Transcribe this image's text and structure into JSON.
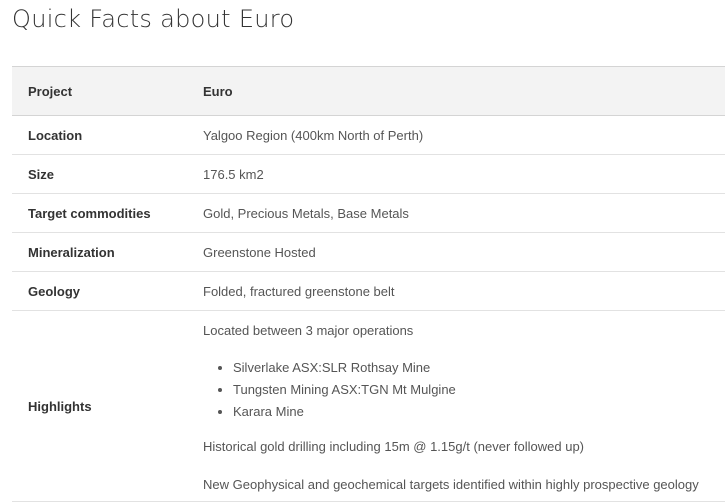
{
  "page": {
    "title": "Quick Facts about Euro"
  },
  "table": {
    "header": {
      "label": "Project",
      "value": "Euro"
    },
    "rows": [
      {
        "label": "Location",
        "value": "Yalgoo Region (400km North of Perth)"
      },
      {
        "label": "Size",
        "value": "176.5 km2"
      },
      {
        "label": "Target commodities",
        "value": "Gold, Precious Metals, Base Metals"
      },
      {
        "label": "Mineralization",
        "value": "Greenstone Hosted"
      },
      {
        "label": "Geology",
        "value": "Folded, fractured greenstone belt"
      }
    ],
    "highlights": {
      "label": "Highlights",
      "intro": "Located between 3 major operations",
      "operations": [
        "Silverlake ASX:SLR Rothsay Mine",
        "Tungsten Mining ASX:TGN Mt Mulgine",
        "Karara Mine"
      ],
      "paragraphs": [
        "Historical gold drilling including 15m @ 1.15g/t (never followed up)",
        "New Geophysical and geochemical targets identified within highly prospective geology"
      ]
    }
  }
}
